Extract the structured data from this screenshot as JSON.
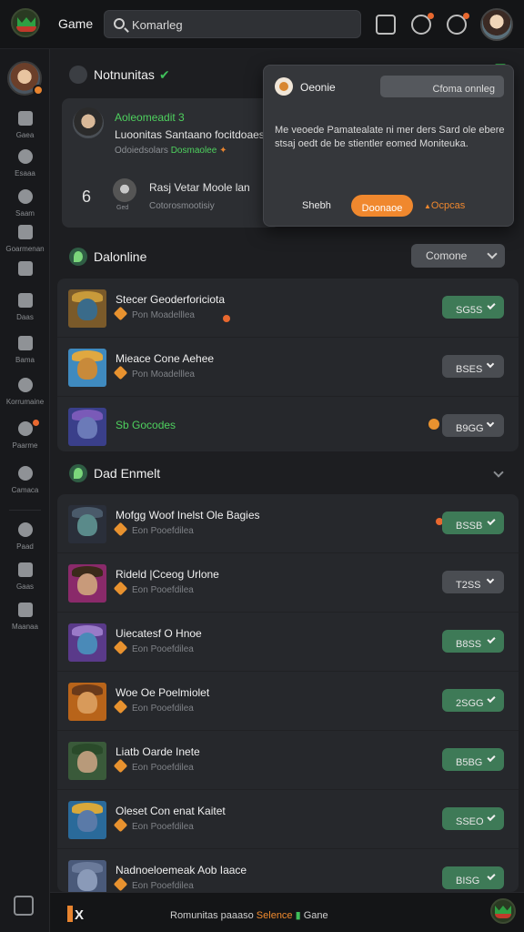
{
  "topbar": {
    "app_title": "Game",
    "search_placeholder": "Komarleg"
  },
  "sidebar": {
    "items": [
      {
        "label": "Gaea"
      },
      {
        "label": "Esaaa"
      },
      {
        "label": "Saam"
      },
      {
        "label": "Goarmenan"
      },
      {
        "label": ""
      },
      {
        "label": "Daas"
      },
      {
        "label": "Bama"
      },
      {
        "label": "Korrumaine"
      },
      {
        "label": "Paarme"
      },
      {
        "label": "Camaca"
      },
      {
        "label": "Paad"
      },
      {
        "label": "Gaas"
      },
      {
        "label": "Maanaa"
      }
    ]
  },
  "friends_section": {
    "title": "Notnunitas",
    "card": {
      "name": "Aoleomeadit 3",
      "line2": "Luoonitas Santaano focitdoaes",
      "line3_prefix": "Odoiedsolars",
      "line3_highlight": "Dosmaolee",
      "number": "6",
      "avatar_label": "Ged",
      "title2": "Rasj Vetar Moole lan",
      "sub2": "Cotorosmootisiy"
    }
  },
  "popup": {
    "title": "Oeonie",
    "top_button": "Cfoma onnleg",
    "body": "Me veoede Pamatealate ni mer ders Sard ole ebere stsaj oedt de be stientler eomed Moniteuka.",
    "action_left": "Shebh",
    "action_primary": "Doonaoe",
    "action_right": "Ocpcas"
  },
  "online_section": {
    "title": "Dalonline",
    "dropdown_value": "Comone",
    "games": [
      {
        "title": "Stecer Geoderforiciota",
        "sub": "Pon Moadelllea",
        "button": "SG5S",
        "state": "green"
      },
      {
        "title": "Mieace Cone Aehee",
        "sub": "Pon Moadelllea",
        "button": "BSES",
        "state": "gray"
      },
      {
        "title": "Sb Gocodes",
        "sub": "",
        "button": "B9GG",
        "state": "gray"
      }
    ]
  },
  "second_section": {
    "title": "Dad Enmelt",
    "games": [
      {
        "title": "Mofgg Woof Inelst Ole Bagies",
        "sub": "Eon Pooefdilea",
        "button": "BSSB",
        "state": "green"
      },
      {
        "title": "Rideld |Cceog Urlone",
        "sub": "Eon Pooefdilea",
        "button": "T2SS",
        "state": "gray"
      },
      {
        "title": "Uiecatesf O Hnoe",
        "sub": "Eon Pooefdilea",
        "button": "B8SS",
        "state": "green"
      },
      {
        "title": "Woe Oe Poelmiolet",
        "sub": "Eon Pooefdilea",
        "button": "2SGG",
        "state": "green"
      },
      {
        "title": "Liatb Oarde Inete",
        "sub": "Eon Pooefdilea",
        "button": "B5BG",
        "state": "green"
      },
      {
        "title": "Oleset Con enat Kaitet",
        "sub": "Eon Pooefdilea",
        "button": "SSEO",
        "state": "green"
      },
      {
        "title": "Nadnoeloemeak Aob Iaace",
        "sub": "Eon Pooefdilea",
        "button": "BISG",
        "state": "green"
      }
    ]
  },
  "bottombar": {
    "text_a": "Romunitas",
    "text_b": "paaaso",
    "text_c": "Selence",
    "text_d": "Gane"
  }
}
